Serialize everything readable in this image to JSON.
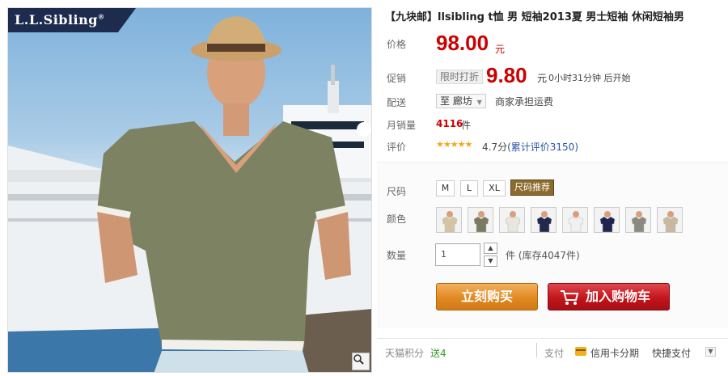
{
  "product": {
    "title": "【九块邮】llsibling t恤 男 短袖2013夏 男士短袖 休闲短袖男",
    "brand": "L.L.Sibling",
    "brand_mark": "®"
  },
  "price": {
    "label": "价格",
    "value": "98.00",
    "unit": "元"
  },
  "promotion": {
    "label": "促销",
    "tag": "限时打折",
    "value": "9.80",
    "unit": "元",
    "countdown": "0小时31分钟 后开始"
  },
  "shipping": {
    "label": "配送",
    "destination": "至 廊坊",
    "note": "商家承担运费"
  },
  "sales": {
    "label": "月销量",
    "value": "4116",
    "unit": "件"
  },
  "review": {
    "label": "评价",
    "stars": "★★★★★",
    "score": "4.7分",
    "count_text": "(累计评价3150)",
    "score_value": 4.7
  },
  "sku": {
    "size_label": "尺码",
    "sizes": [
      "M",
      "L",
      "XL"
    ],
    "size_tip": "尺码推荐",
    "color_label": "颜色",
    "colors": [
      "#d6c3a4",
      "#7a7a60",
      "#e9e6df",
      "#1f2a4d",
      "#f0f0f0",
      "#1e2650",
      "#8a8a80",
      "#c8b8a2"
    ],
    "qty_label": "数量",
    "qty_value": "1",
    "stock": "件 (库存4047件)"
  },
  "actions": {
    "buy": "立刻购买",
    "cart": "加入购物车"
  },
  "footer": {
    "points_label": "天猫积分",
    "points_value": "送4",
    "pay_label": "支付",
    "credit": "信用卡分期",
    "quick_pay": "快捷支付"
  },
  "colors": {
    "accent_red": "#cc0000",
    "buy_orange": "#e18a22",
    "cart_red": "#c3151c",
    "link_blue": "#2953a6"
  }
}
